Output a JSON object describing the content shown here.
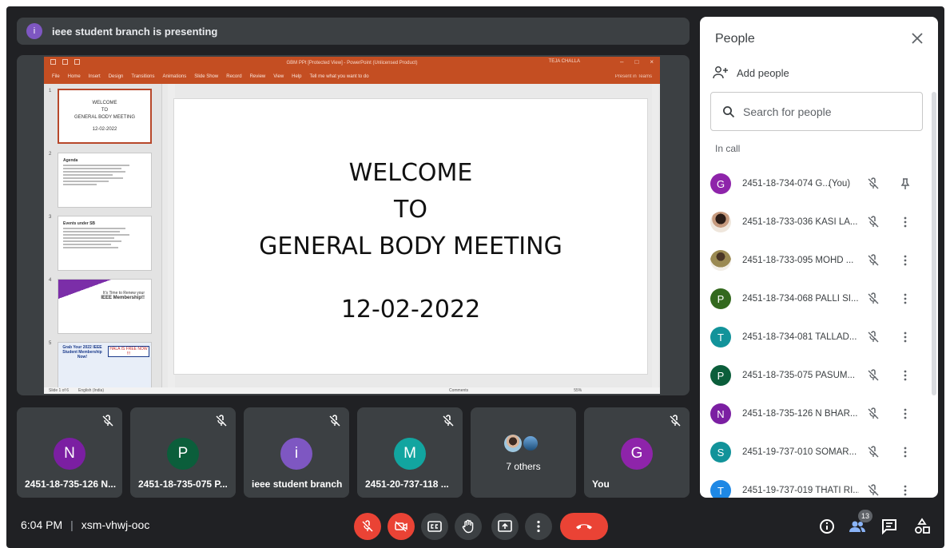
{
  "presenting": {
    "avatar_letter": "i",
    "text": "ieee student branch is presenting"
  },
  "ppt": {
    "window_title": "GBM PPt [Protected View] - PowerPoint (Unlicensed Product)",
    "user": "TEJA CHALLA",
    "menu": [
      "File",
      "Home",
      "Insert",
      "Design",
      "Transitions",
      "Animations",
      "Slide Show",
      "Record",
      "Review",
      "View",
      "Help",
      "Tell me what you want to do"
    ],
    "share": "Present in Teams",
    "thumb_numbers": [
      "1",
      "2",
      "3",
      "4",
      "5"
    ],
    "thumb1_lines": [
      "WELCOME",
      "TO",
      "GENERAL BODY MEETING",
      "12-02-2022"
    ],
    "thumb2_title": "Agenda",
    "thumb3_title": "Events under SB",
    "thumb4_lines": [
      "It's Time to Renew your",
      "IEEE Membership!!"
    ],
    "thumb5_lines": [
      "Grab Your 2022 IEEE Student Membership Now!",
      "HALA IS FREE NOW !!!"
    ],
    "slide_lines": [
      "WELCOME",
      "TO",
      "GENERAL BODY MEETING"
    ],
    "slide_date": "12-02-2022",
    "status_left": "Slide 1 of 6",
    "status_lang": "English (India)",
    "status_comments": "Comments",
    "zoom": "55%"
  },
  "tiles": [
    {
      "letter": "N",
      "color": "#7b1fa2",
      "name": "2451-18-735-126 N..."
    },
    {
      "letter": "P",
      "color": "#0b5e3b",
      "name": "2451-18-735-075 P..."
    },
    {
      "letter": "i",
      "color": "#7e57c2",
      "name": "ieee student branch"
    },
    {
      "letter": "M",
      "color": "#12a5a0",
      "name": "2451-20-737-118 ..."
    },
    {
      "others": "7 others"
    },
    {
      "letter": "G",
      "color": "#8e24aa",
      "name": "You"
    }
  ],
  "people": {
    "title": "People",
    "add_label": "Add people",
    "search_placeholder": "Search for people",
    "section": "In call",
    "rows": [
      {
        "letter": "G",
        "color": "#8e24aa",
        "name": "2451-18-734-074 G...",
        "you": "(You)"
      },
      {
        "letter": "",
        "color": "#caa58d",
        "name": "2451-18-733-036 KASI LA..."
      },
      {
        "letter": "",
        "color": "#d8c8b2",
        "name": "2451-18-733-095 MOHD ..."
      },
      {
        "letter": "P",
        "color": "#33691e",
        "name": "2451-18-734-068 PALLI SI..."
      },
      {
        "letter": "T",
        "color": "#12939a",
        "name": "2451-18-734-081 TALLAD..."
      },
      {
        "letter": "P",
        "color": "#0b5e3b",
        "name": "2451-18-735-075 PASUM..."
      },
      {
        "letter": "N",
        "color": "#7b1fa2",
        "name": "2451-18-735-126 N BHAR..."
      },
      {
        "letter": "S",
        "color": "#12939a",
        "name": "2451-19-737-010 SOMAR..."
      },
      {
        "letter": "T",
        "color": "#1e88e5",
        "name": "2451-19-737-019 THATI RI..."
      }
    ]
  },
  "bottom": {
    "time": "6:04 PM",
    "separator": "|",
    "meeting_code": "xsm-vhwj-ooc",
    "participant_count": "13"
  }
}
